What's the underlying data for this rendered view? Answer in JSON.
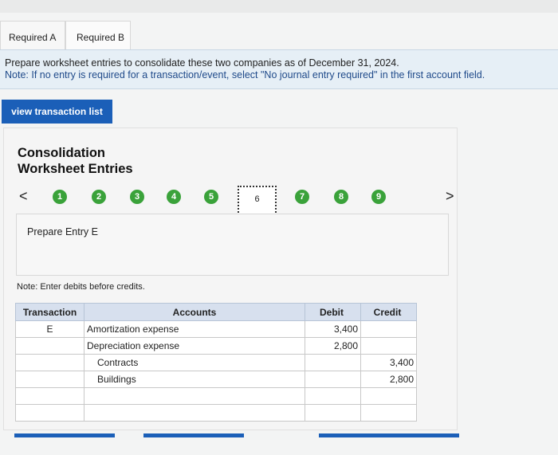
{
  "tabs": [
    {
      "label": "Required A"
    },
    {
      "label": "Required B"
    }
  ],
  "instructions": {
    "line1": "Prepare worksheet entries to consolidate these two companies as of December 31, 2024.",
    "line2": "Note: If no entry is required for a transaction/event, select \"No journal entry required\" in the first account field."
  },
  "view_transaction_button": "view transaction list",
  "panel": {
    "title_line1": "Consolidation",
    "title_line2": "Worksheet Entries",
    "nav_prev": "<",
    "nav_next": ">",
    "steps": [
      "1",
      "2",
      "3",
      "4",
      "5",
      "6",
      "7",
      "8",
      "9"
    ],
    "entry_label": "Prepare Entry E",
    "note": "Note: Enter debits before credits."
  },
  "table": {
    "headers": {
      "transaction": "Transaction",
      "accounts": "Accounts",
      "debit": "Debit",
      "credit": "Credit"
    },
    "rows": [
      {
        "transaction": "E",
        "account": "Amortization expense",
        "debit": "3,400",
        "credit": ""
      },
      {
        "transaction": "",
        "account": "Depreciation expense",
        "debit": "2,800",
        "credit": ""
      },
      {
        "transaction": "",
        "account": "Contracts",
        "debit": "",
        "credit": "3,400"
      },
      {
        "transaction": "",
        "account": "Buildings",
        "debit": "",
        "credit": "2,800"
      },
      {
        "transaction": "",
        "account": "",
        "debit": "",
        "credit": ""
      },
      {
        "transaction": "",
        "account": "",
        "debit": "",
        "credit": ""
      }
    ]
  },
  "colors": {
    "accent": "#1b5fb8",
    "step_done": "#3aa23a",
    "header_bg": "#d7e0ee"
  }
}
